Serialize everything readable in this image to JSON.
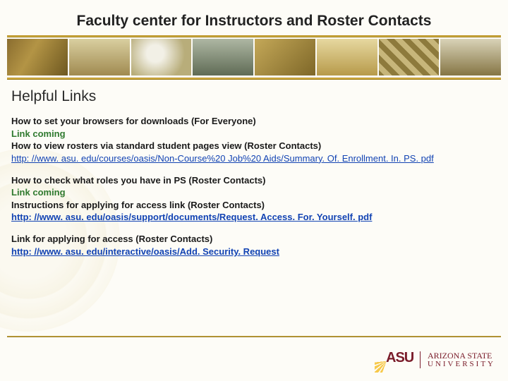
{
  "title": "Faculty center for Instructors and Roster Contacts",
  "section_title": "Helpful Links",
  "items": {
    "h1": "How to set your browsers for downloads (For Everyone)",
    "l1": "Link coming",
    "h2": "How to view rosters via standard student pages view (Roster Contacts)",
    "u2": " http: //www. asu. edu/courses/oasis/Non-Course%20 Job%20 Aids/Summary. Of. Enrollment. In. PS. pdf ",
    "h3": "How to check what roles you have in PS (Roster Contacts)",
    "l3": "Link coming",
    "h4": "Instructions for applying for access link (Roster Contacts)",
    "u4": "http: //www. asu. edu/oasis/support/documents/Request. Access. For. Yourself. pdf",
    "h5": "Link for applying for access (Roster Contacts)",
    "u5": "http: //www. asu. edu/interactive/oasis/Add. Security. Request"
  },
  "logo": {
    "mark": "ASU",
    "line1": "ARIZONA STATE",
    "line2": "UNIVERSITY"
  }
}
